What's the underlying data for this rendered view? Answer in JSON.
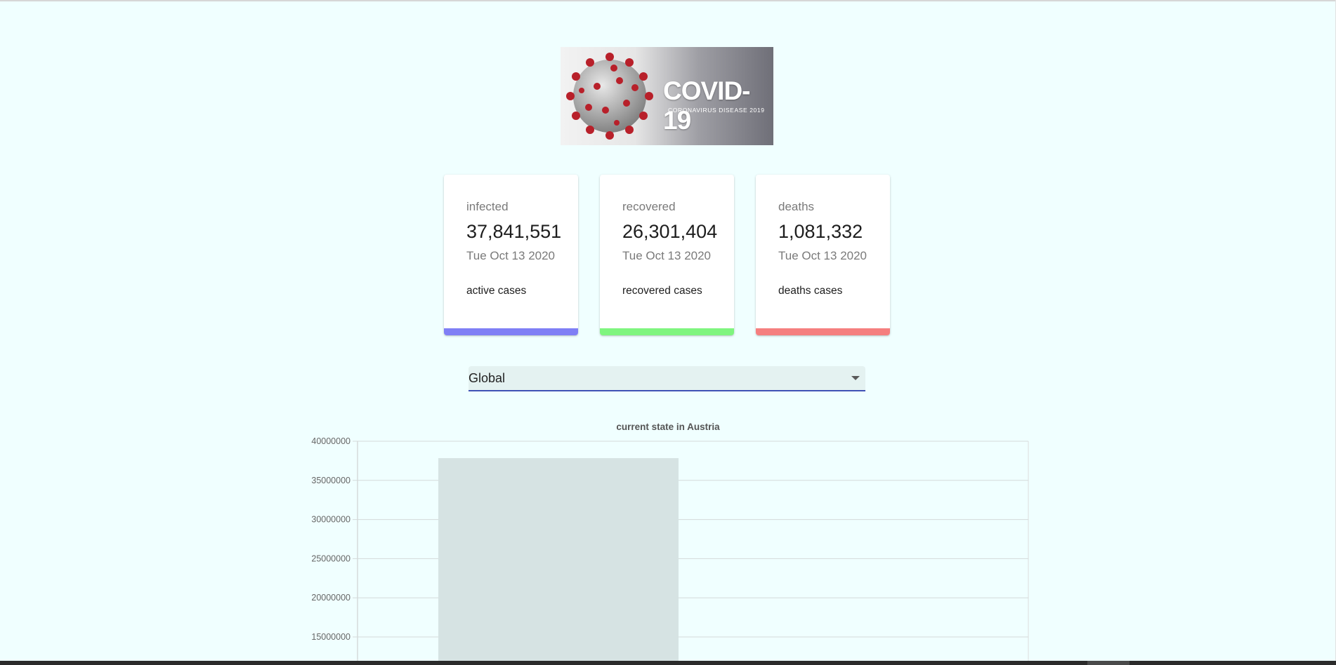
{
  "logo": {
    "title": "COVID-19",
    "subtitle": "CORONAVIRUS DISEASE 2019"
  },
  "cards": [
    {
      "title": "infected",
      "value": "37,841,551",
      "date": "Tue Oct 13 2020",
      "description": "active cases",
      "color": "#7f7ff5"
    },
    {
      "title": "recovered",
      "value": "26,301,404",
      "date": "Tue Oct 13 2020",
      "description": "recovered cases",
      "color": "#7ff57f"
    },
    {
      "title": "deaths",
      "value": "1,081,332",
      "date": "Tue Oct 13 2020",
      "description": "deaths cases",
      "color": "#f57f7f"
    }
  ],
  "country_select": {
    "value": "Global"
  },
  "chart_data": {
    "type": "bar",
    "title": "current state in Austria",
    "values": [
      37841551
    ],
    "ylim": [
      0,
      40000000
    ],
    "yticks": [
      "40000000",
      "35000000",
      "30000000",
      "25000000",
      "20000000",
      "15000000"
    ],
    "bar_color": "#d6e3e3",
    "grid": true
  }
}
